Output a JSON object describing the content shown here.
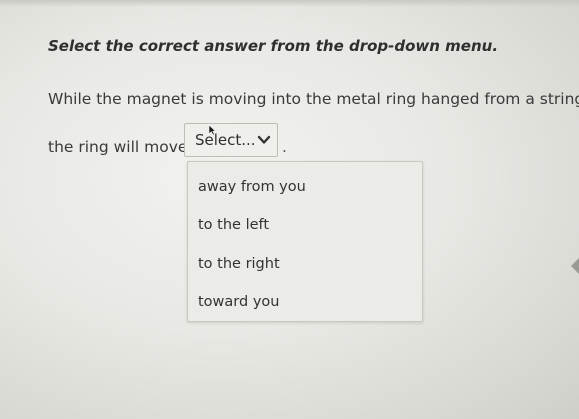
{
  "question": {
    "instruction": "Select the correct answer from the drop-down menu.",
    "line1": "While the magnet is moving into the metal ring hanged from a string,",
    "line2_prefix": "the ring will move",
    "line2_suffix": "."
  },
  "dropdown": {
    "selected": "Select...",
    "icon": "chevron-down-icon",
    "options": [
      "away from you",
      "to the left",
      "to the right",
      "toward you"
    ]
  }
}
